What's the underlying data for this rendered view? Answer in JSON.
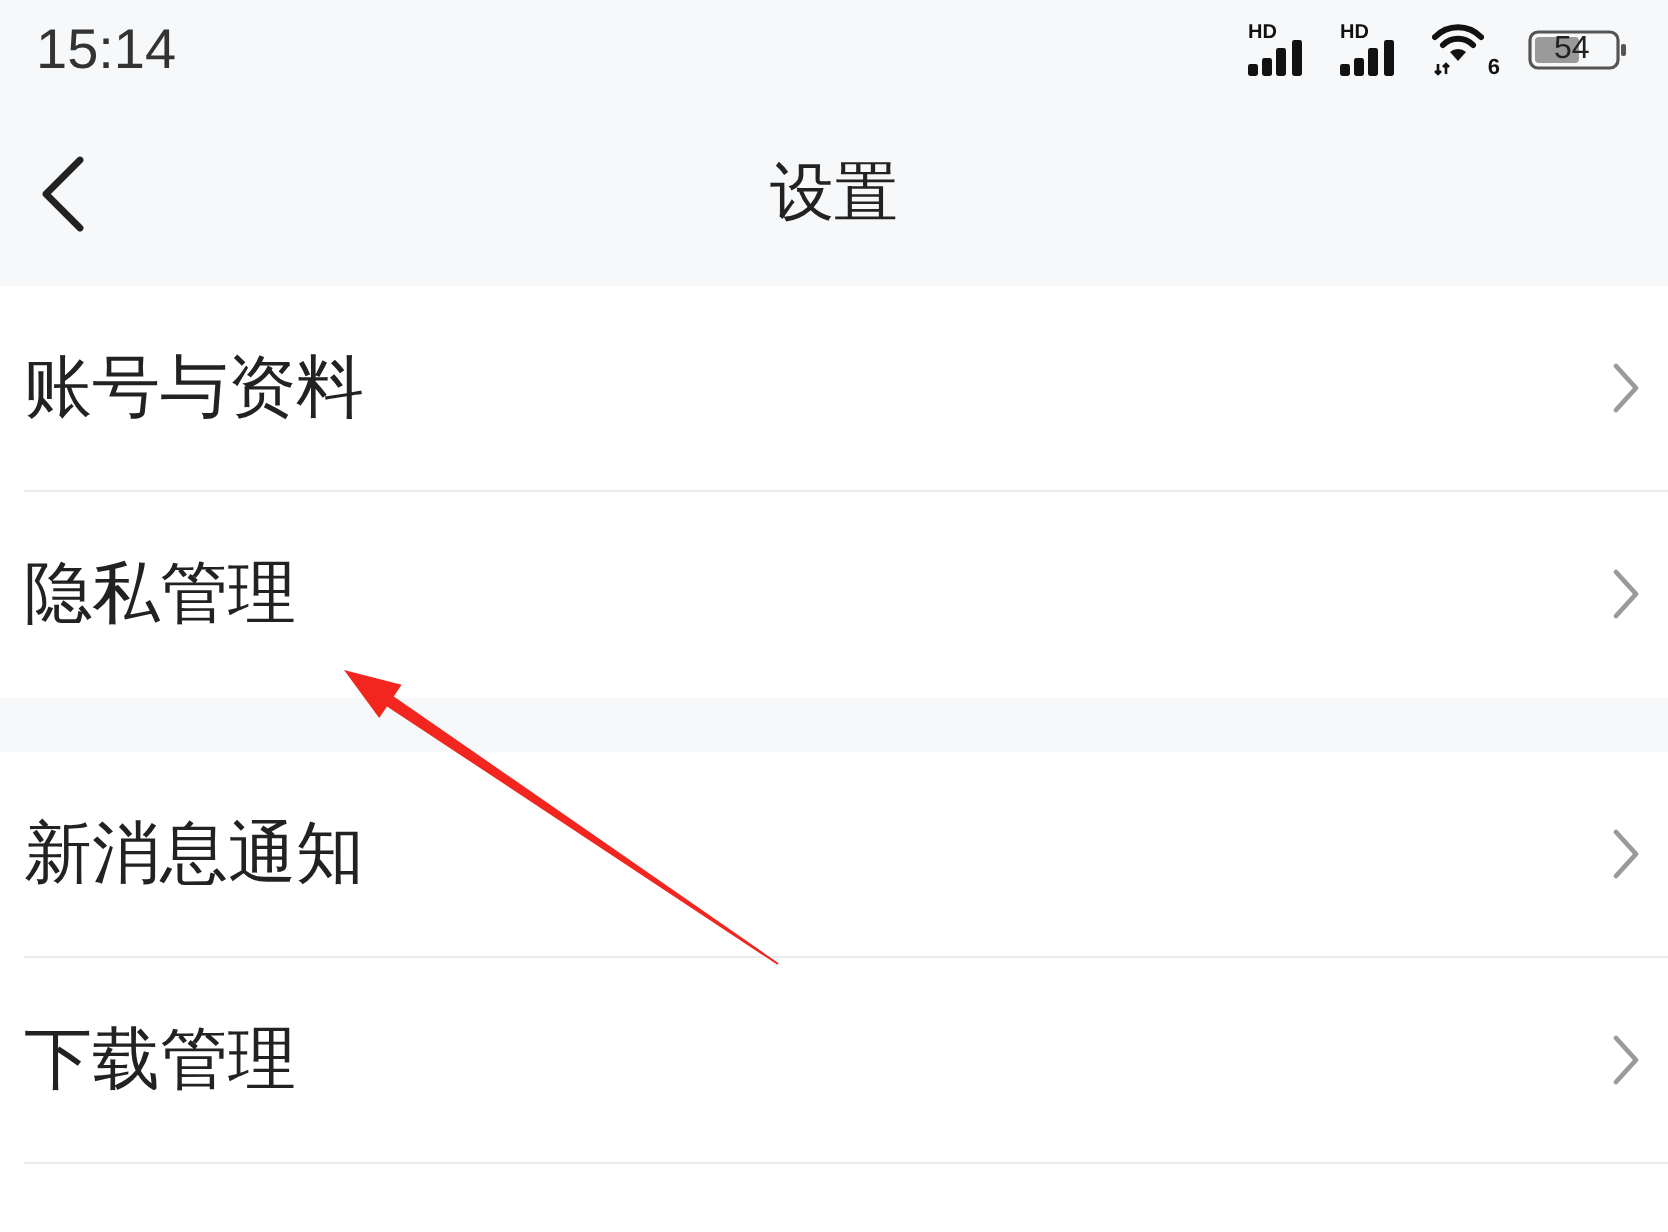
{
  "status_bar": {
    "time": "15:14",
    "signals": [
      {
        "label": "HD"
      },
      {
        "label": "HD"
      }
    ],
    "wifi": {
      "label": "6"
    },
    "battery": {
      "label": "54"
    }
  },
  "nav_bar": {
    "title": "设置"
  },
  "groups": [
    {
      "items": [
        {
          "label": "账号与资料"
        },
        {
          "label": "隐私管理"
        }
      ]
    },
    {
      "items": [
        {
          "label": "新消息通知"
        },
        {
          "label": "下载管理"
        }
      ]
    }
  ],
  "annotation": {
    "kind": "arrow"
  }
}
